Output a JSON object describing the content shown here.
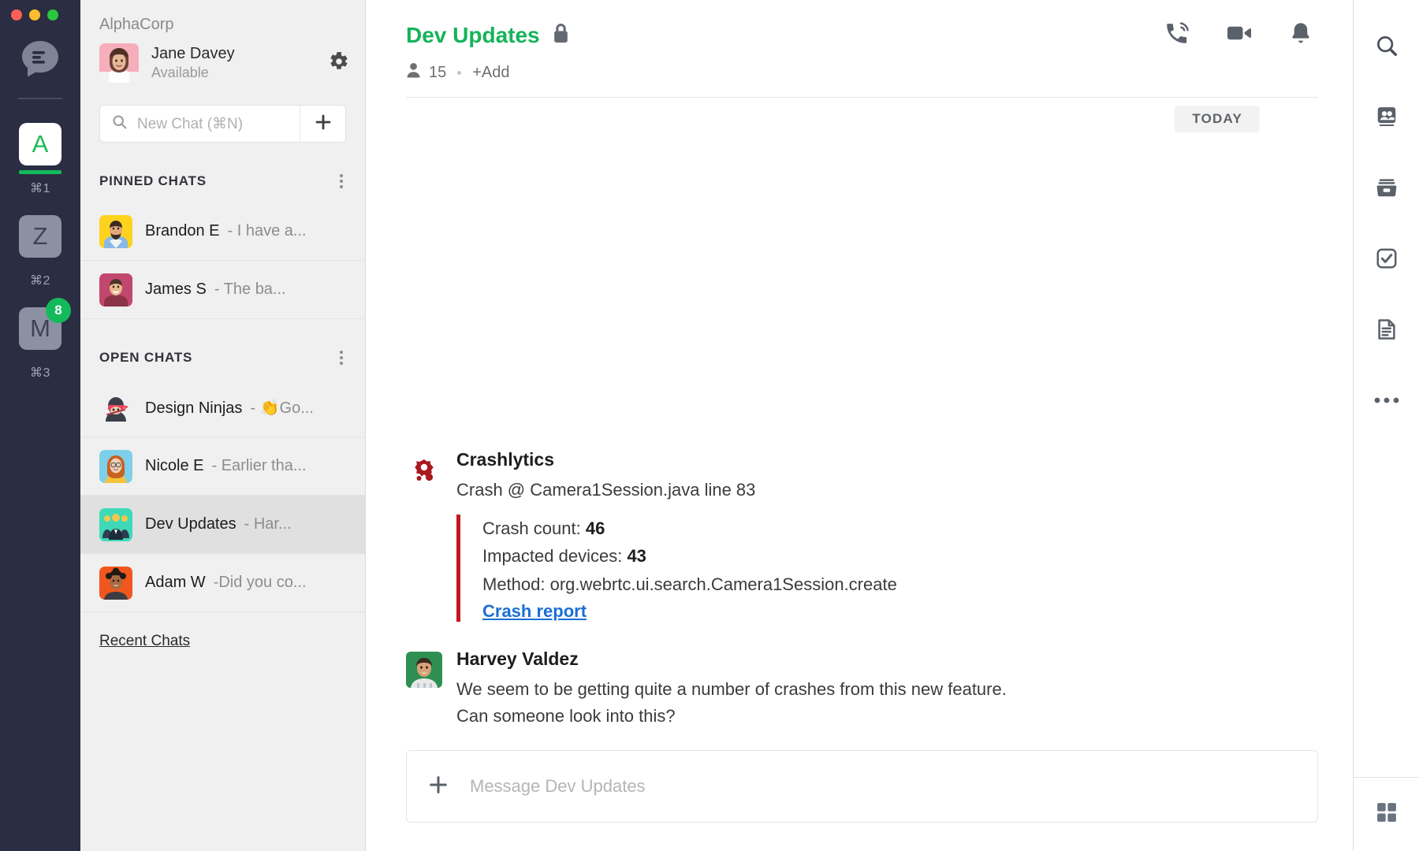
{
  "window": {
    "traffic_lights": [
      "close",
      "minimize",
      "maximize"
    ]
  },
  "rail": {
    "logo_icon": "chat-bubble-logo-icon",
    "items": [
      {
        "letter": "A",
        "shortcut": "⌘1",
        "active": true,
        "badge": ""
      },
      {
        "letter": "Z",
        "shortcut": "⌘2",
        "active": false,
        "badge": ""
      },
      {
        "letter": "M",
        "shortcut": "⌘3",
        "active": false,
        "badge": "8"
      }
    ]
  },
  "sidebar": {
    "org_name": "AlphaCorp",
    "user": {
      "name": "Jane Davey",
      "status": "Available",
      "settings_icon": "gear-icon"
    },
    "search": {
      "placeholder": "New Chat (⌘N)",
      "search_icon": "search-icon",
      "add_icon": "plus-icon"
    },
    "sections": [
      {
        "title": "PINNED CHATS",
        "menu_icon": "kebab-menu-icon",
        "chats": [
          {
            "name": "Brandon E",
            "preview": "- I have a...",
            "selected": false
          },
          {
            "name": "James S",
            "preview": "- The ba...",
            "selected": false
          }
        ]
      },
      {
        "title": "OPEN CHATS",
        "menu_icon": "kebab-menu-icon",
        "chats": [
          {
            "name": "Design Ninjas",
            "preview": "- 👏Go...",
            "selected": false
          },
          {
            "name": "Nicole E",
            "preview": "- Earlier tha...",
            "selected": false
          },
          {
            "name": "Dev Updates",
            "preview": "- Har...",
            "selected": true
          },
          {
            "name": "Adam W",
            "preview": "-Did you co...",
            "selected": false
          }
        ]
      }
    ],
    "recent_link": "Recent Chats"
  },
  "chat": {
    "title": "Dev Updates",
    "private_icon": "lock-icon",
    "member_icon": "person-icon",
    "member_count": "15",
    "add_label": "+Add",
    "actions": [
      {
        "name": "call-icon",
        "label": "Call"
      },
      {
        "name": "video-icon",
        "label": "Video"
      },
      {
        "name": "bell-icon",
        "label": "Notifications"
      }
    ],
    "day_separator": "TODAY",
    "messages": [
      {
        "author": "Crashlytics",
        "avatar": "crashlytics-bot-avatar",
        "text": "Crash @ Camera1Session.java line 83",
        "attachment": {
          "accent_color": "#c2161c",
          "lines": [
            {
              "label": "Crash count:",
              "value": "46"
            },
            {
              "label": "Impacted devices:",
              "value": "43"
            },
            {
              "label": "Method:",
              "value": "org.webrtc.ui.search.Camera1Session.create"
            }
          ],
          "link": "Crash report"
        }
      },
      {
        "author": "Harvey Valdez",
        "avatar": "harvey-valdez-avatar",
        "lines": [
          "We seem to be getting quite a number of crashes from this new feature.",
          "Can someone look into this?"
        ]
      }
    ],
    "composer": {
      "placeholder": "Message Dev Updates",
      "add_icon": "plus-icon"
    }
  },
  "right_rail": {
    "items": [
      {
        "icon": "search-icon",
        "label": "Search"
      },
      {
        "icon": "contacts-icon",
        "label": "Contacts"
      },
      {
        "icon": "archive-icon",
        "label": "Archive"
      },
      {
        "icon": "tasks-check-icon",
        "label": "Tasks"
      },
      {
        "icon": "notes-document-icon",
        "label": "Notes"
      },
      {
        "icon": "more-dots-icon",
        "label": "More"
      }
    ],
    "bottom": {
      "icon": "apps-grid-icon",
      "label": "Apps"
    }
  },
  "colors": {
    "accent_green": "#16b35a",
    "rail_bg": "#2b2d42",
    "link_blue": "#1a6fd4",
    "attachment_red": "#c2161c"
  }
}
